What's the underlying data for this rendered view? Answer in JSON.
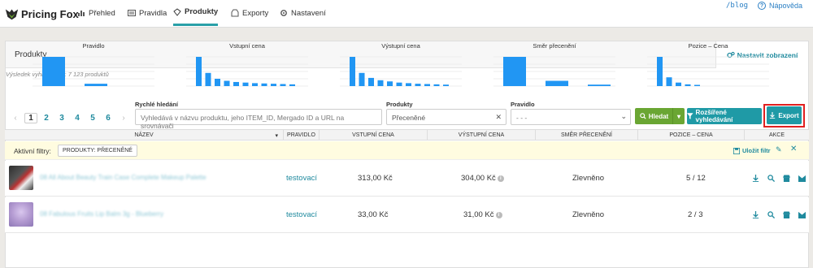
{
  "app": {
    "brand": "Pricing Fox",
    "nav": [
      {
        "label": "Přehled",
        "icon": "overview-icon",
        "active": false
      },
      {
        "label": "Pravidla",
        "icon": "rules-icon",
        "active": false
      },
      {
        "label": "Produkty",
        "icon": "products-icon",
        "active": true
      },
      {
        "label": "Exporty",
        "icon": "exports-icon",
        "active": false
      },
      {
        "label": "Nastavení",
        "icon": "settings-icon",
        "active": false
      }
    ],
    "blog_link": "/blog",
    "help_link": "Nápověda"
  },
  "panel": {
    "title": "Produkty",
    "settings_button": "Nastavit zobrazení",
    "results_text": "Výsledek vyhledávání: 7 123 produktů"
  },
  "mini_charts": [
    {
      "title": "Pravidlo",
      "values": [
        1.0,
        0.08
      ]
    },
    {
      "title": "Vstupní cena",
      "values": [
        1.0,
        0.45,
        0.25,
        0.18,
        0.14,
        0.12,
        0.1,
        0.09,
        0.08,
        0.07,
        0.06
      ]
    },
    {
      "title": "Výstupní cena",
      "values": [
        1.0,
        0.45,
        0.28,
        0.2,
        0.16,
        0.12,
        0.1,
        0.08,
        0.07,
        0.06,
        0.05
      ]
    },
    {
      "title": "Směr přecenění",
      "values": [
        1.0,
        0.18,
        0.05
      ]
    },
    {
      "title": "Pozice – Cena",
      "values": [
        1.0,
        0.3,
        0.12,
        0.06,
        0.04
      ]
    }
  ],
  "pagination": {
    "prev": "‹",
    "next": "›",
    "pages": [
      "1",
      "2",
      "3",
      "4",
      "5",
      "6"
    ],
    "current": "1"
  },
  "filters": {
    "quick_search_label": "Rychlé hledání",
    "quick_search_placeholder": "Vyhledává v názvu produktu, jeho ITEM_ID, Mergado ID a URL na srovnávači",
    "products_label": "Produkty",
    "products_value": "Přeceněné",
    "rule_label": "Pravidlo",
    "rule_value": "- - -",
    "search_button": "Hledat",
    "advanced_button": "Rozšířené vyhledávání",
    "export_button": "Export"
  },
  "table": {
    "columns": [
      "NÁZEV",
      "PRAVIDLO",
      "VSTUPNÍ CENA",
      "VÝSTUPNÍ CENA",
      "SMĚR PŘECENĚNÍ",
      "POZICE – CENA",
      "AKCE"
    ],
    "active_filters_label": "Aktivní filtry:",
    "active_filter_chip": "PRODUKTY: PŘECENĚNÉ",
    "save_filter": "Uložit filtr",
    "rows": [
      {
        "name": "08 All About Beauty Train Case Complete Makeup Palette",
        "rule": "testovací",
        "input_price": "313,00 Kč",
        "output_price": "304,00 Kč",
        "direction": "Zlevněno",
        "position": "5 / 12",
        "thumb_color": "#3a3a3a"
      },
      {
        "name": "08 Fabulous Fruits Lip Balm 3g - Blueberry",
        "rule": "testovací",
        "input_price": "33,00 Kč",
        "output_price": "31,00 Kč",
        "direction": "Zlevněno",
        "position": "2 / 3",
        "thumb_color": "#b39ad1"
      }
    ]
  },
  "colors": {
    "accent": "#1f9aa6",
    "green": "#6aa633",
    "bar": "#2196f3",
    "highlight": "#e02020"
  }
}
